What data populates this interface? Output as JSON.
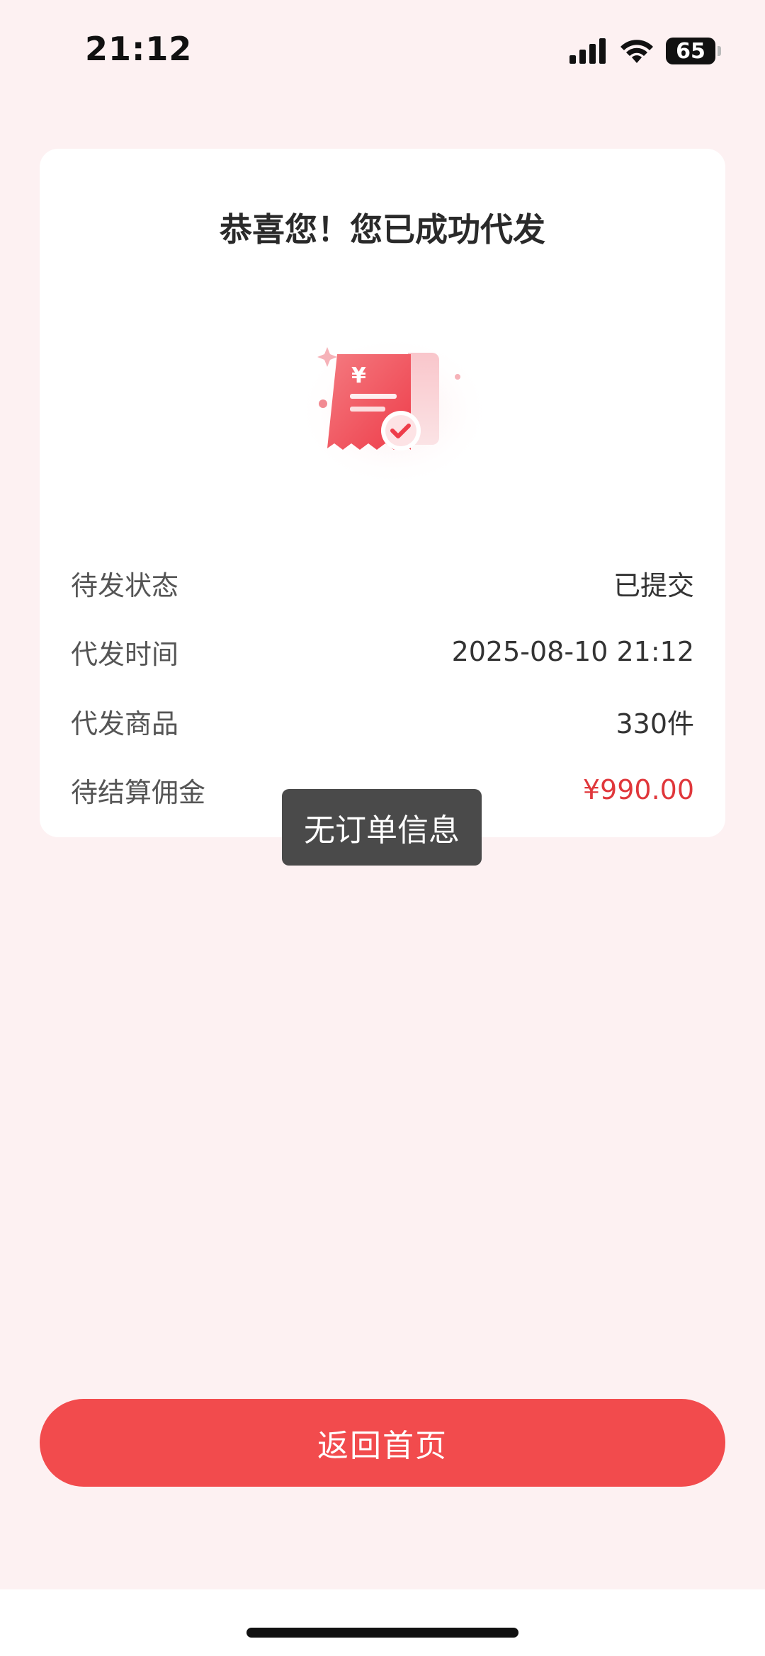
{
  "status_bar": {
    "time": "21:12",
    "battery": "65",
    "icons": [
      "signal-icon",
      "wifi-icon",
      "battery-icon"
    ]
  },
  "card": {
    "title": "恭喜您！您已成功代发",
    "illustration": "receipt-check-icon",
    "rows": [
      {
        "label": "待发状态",
        "value": "已提交"
      },
      {
        "label": "代发时间",
        "value": "2025-08-10 21:12"
      },
      {
        "label": "代发商品",
        "value": "330件"
      },
      {
        "label": "待结算佣金",
        "value": "¥990.00"
      }
    ]
  },
  "toast": {
    "text": "无订单信息"
  },
  "home_button": {
    "label": "返回首页"
  },
  "colors": {
    "background": "#fdf1f2",
    "accent": "#f24b4d",
    "commission": "#e0373b",
    "toast_bg": "#4a4a4a"
  }
}
